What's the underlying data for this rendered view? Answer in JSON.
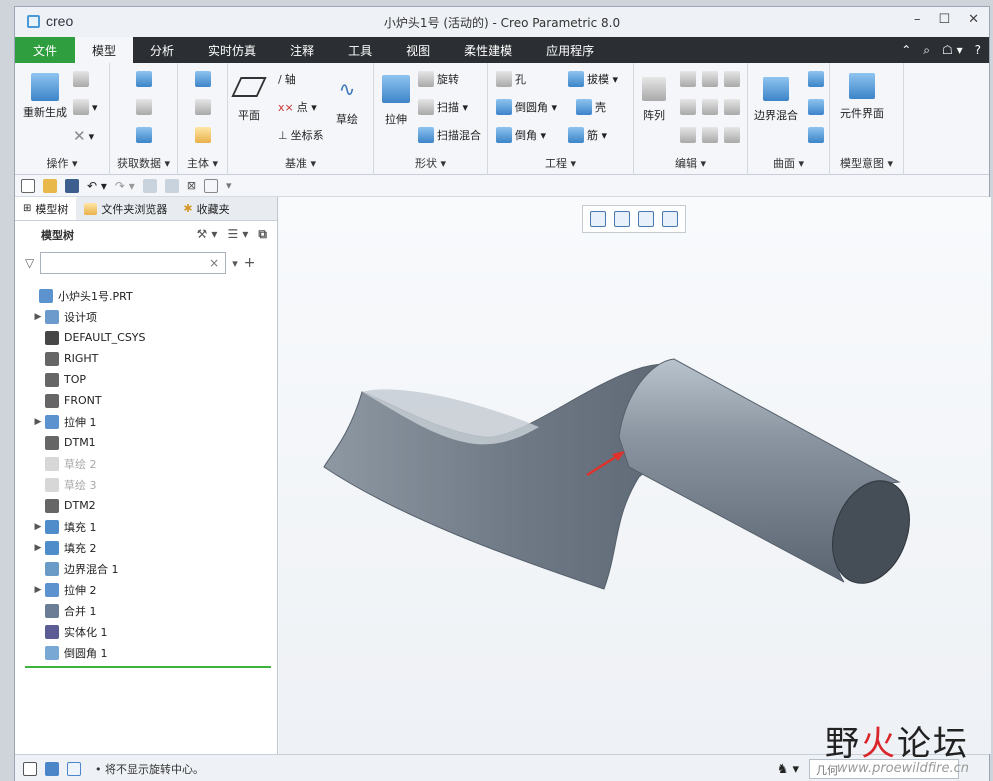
{
  "window": {
    "app_logo": "creo",
    "title": "小炉头1号 (活动的) - Creo Parametric 8.0",
    "controls": [
      "–",
      "☐",
      "✕"
    ]
  },
  "tabs": [
    "文件",
    "模型",
    "分析",
    "实时仿真",
    "注释",
    "工具",
    "视图",
    "柔性建模",
    "应用程序"
  ],
  "active_tab": "模型",
  "ribbon": {
    "groups": [
      {
        "label": "操作 ▾",
        "items": [
          "重新生成"
        ]
      },
      {
        "label": "获取数据 ▾",
        "items": []
      },
      {
        "label": "主体 ▾",
        "items": []
      },
      {
        "label": "基准 ▾",
        "items": [
          "平面",
          "轴",
          "点 ▾",
          "坐标系",
          "草绘"
        ]
      },
      {
        "label": "形状 ▾",
        "items": [
          "拉伸",
          "旋转",
          "扫描 ▾",
          "扫描混合"
        ]
      },
      {
        "label": "工程 ▾",
        "items": [
          "孔",
          "拔模 ▾",
          "倒圆角 ▾",
          "壳",
          "倒角 ▾",
          "筋 ▾"
        ]
      },
      {
        "label": "编辑 ▾",
        "items": [
          "阵列"
        ]
      },
      {
        "label": "曲面 ▾",
        "items": [
          "边界混合"
        ]
      },
      {
        "label": "模型意图 ▾",
        "items": [
          "元件界面"
        ]
      }
    ]
  },
  "left_panel": {
    "tabs": [
      "模型树",
      "文件夹浏览器",
      "收藏夹"
    ],
    "header": "模型树",
    "filter_placeholder": "",
    "tree": [
      {
        "label": "小炉头1号.PRT",
        "expand": "",
        "dim": false
      },
      {
        "label": "设计项",
        "expand": "▶",
        "dim": false
      },
      {
        "label": "DEFAULT_CSYS",
        "expand": "",
        "dim": false
      },
      {
        "label": "RIGHT",
        "expand": "",
        "dim": false
      },
      {
        "label": "TOP",
        "expand": "",
        "dim": false
      },
      {
        "label": "FRONT",
        "expand": "",
        "dim": false
      },
      {
        "label": "拉伸 1",
        "expand": "▶",
        "dim": false
      },
      {
        "label": "DTM1",
        "expand": "",
        "dim": false
      },
      {
        "label": "草绘 2",
        "expand": "",
        "dim": true
      },
      {
        "label": "草绘 3",
        "expand": "",
        "dim": true
      },
      {
        "label": "DTM2",
        "expand": "",
        "dim": false
      },
      {
        "label": "填充 1",
        "expand": "▶",
        "dim": false
      },
      {
        "label": "填充 2",
        "expand": "▶",
        "dim": false
      },
      {
        "label": "边界混合 1",
        "expand": "",
        "dim": false
      },
      {
        "label": "拉伸 2",
        "expand": "▶",
        "dim": false
      },
      {
        "label": "合并 1",
        "expand": "",
        "dim": false
      },
      {
        "label": "实体化 1",
        "expand": "",
        "dim": false
      },
      {
        "label": "倒圆角 1",
        "expand": "",
        "dim": false
      }
    ]
  },
  "status": {
    "message": "• 将不显示旋转中心。",
    "filter_value": "几何"
  },
  "watermark": {
    "title_black_1": "野",
    "title_red": "火",
    "title_black_2": "论坛",
    "url": "www.proewildfire.cn"
  },
  "colors": {
    "file_tab": "#2e9e3f",
    "tab_bar": "#2b2f33",
    "model_surface": "#7d8894",
    "arrow": "#e0312b"
  }
}
